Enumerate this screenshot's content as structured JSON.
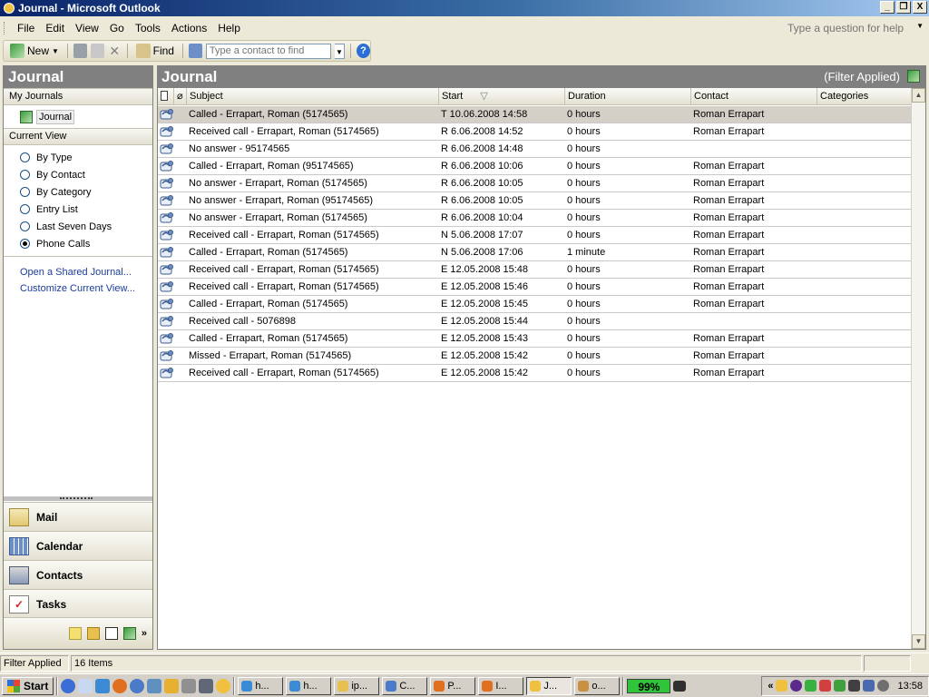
{
  "window": {
    "title": "Journal - Microsoft Outlook",
    "min_label": "_",
    "max_label": "❐",
    "close_label": "X"
  },
  "menu": {
    "items": [
      "File",
      "Edit",
      "View",
      "Go",
      "Tools",
      "Actions",
      "Help"
    ],
    "ask_placeholder": "Type a question for help"
  },
  "toolbar": {
    "new_label": "New",
    "find_label": "Find",
    "contact_placeholder": "Type a contact to find"
  },
  "nav": {
    "title": "Journal",
    "my_journals_label": "My Journals",
    "journal_item": "Journal",
    "current_view_label": "Current View",
    "views": [
      {
        "label": "By Type",
        "selected": false
      },
      {
        "label": "By Contact",
        "selected": false
      },
      {
        "label": "By Category",
        "selected": false
      },
      {
        "label": "Entry List",
        "selected": false
      },
      {
        "label": "Last Seven Days",
        "selected": false
      },
      {
        "label": "Phone Calls",
        "selected": true
      }
    ],
    "links": [
      "Open a Shared Journal...",
      "Customize Current View..."
    ],
    "buttons": [
      "Mail",
      "Calendar",
      "Contacts",
      "Tasks"
    ]
  },
  "main": {
    "title": "Journal",
    "filter_status": "(Filter Applied)",
    "columns": [
      "Subject",
      "Start",
      "Duration",
      "Contact",
      "Categories"
    ],
    "sort_indicator": "▽",
    "rows": [
      {
        "subject": "Called - Errapart, Roman (5174565)",
        "start": "T 10.06.2008 14:58",
        "duration": "0 hours",
        "contact": "Roman Errapart"
      },
      {
        "subject": "Received call - Errapart, Roman (5174565)",
        "start": "R 6.06.2008 14:52",
        "duration": "0 hours",
        "contact": "Roman Errapart"
      },
      {
        "subject": "No answer - 95174565",
        "start": "R 6.06.2008 14:48",
        "duration": "0 hours",
        "contact": ""
      },
      {
        "subject": "Called - Errapart, Roman (95174565)",
        "start": "R 6.06.2008 10:06",
        "duration": "0 hours",
        "contact": "Roman Errapart"
      },
      {
        "subject": "No answer - Errapart, Roman (5174565)",
        "start": "R 6.06.2008 10:05",
        "duration": "0 hours",
        "contact": "Roman Errapart"
      },
      {
        "subject": "No answer - Errapart, Roman (95174565)",
        "start": "R 6.06.2008 10:05",
        "duration": "0 hours",
        "contact": "Roman Errapart"
      },
      {
        "subject": "No answer - Errapart, Roman (5174565)",
        "start": "R 6.06.2008 10:04",
        "duration": "0 hours",
        "contact": "Roman Errapart"
      },
      {
        "subject": "Received call - Errapart, Roman (5174565)",
        "start": "N 5.06.2008 17:07",
        "duration": "0 hours",
        "contact": "Roman Errapart"
      },
      {
        "subject": "Called - Errapart, Roman (5174565)",
        "start": "N 5.06.2008 17:06",
        "duration": "1 minute",
        "contact": "Roman Errapart"
      },
      {
        "subject": "Received call - Errapart, Roman (5174565)",
        "start": "E 12.05.2008 15:48",
        "duration": "0 hours",
        "contact": "Roman Errapart"
      },
      {
        "subject": "Received call - Errapart, Roman (5174565)",
        "start": "E 12.05.2008 15:46",
        "duration": "0 hours",
        "contact": "Roman Errapart"
      },
      {
        "subject": "Called - Errapart, Roman (5174565)",
        "start": "E 12.05.2008 15:45",
        "duration": "0 hours",
        "contact": "Roman Errapart"
      },
      {
        "subject": "Received call - 5076898",
        "start": "E 12.05.2008 15:44",
        "duration": "0 hours",
        "contact": ""
      },
      {
        "subject": "Called - Errapart, Roman (5174565)",
        "start": "E 12.05.2008 15:43",
        "duration": "0 hours",
        "contact": "Roman Errapart"
      },
      {
        "subject": "Missed - Errapart, Roman (5174565)",
        "start": "E 12.05.2008 15:42",
        "duration": "0 hours",
        "contact": "Roman Errapart"
      },
      {
        "subject": "Received call - Errapart, Roman (5174565)",
        "start": "E 12.05.2008 15:42",
        "duration": "0 hours",
        "contact": "Roman Errapart"
      }
    ]
  },
  "status": {
    "filter": "Filter Applied",
    "count": "16 Items"
  },
  "taskbar": {
    "start_label": "Start",
    "tasks": [
      "h...",
      "h...",
      "ip...",
      "C...",
      "P...",
      "I...",
      "J...",
      "o..."
    ],
    "battery": "99%",
    "clock": "13:58",
    "tray_chevron": "«"
  },
  "colors": {
    "titlebar": "#0a246a",
    "pane_header": "#808080",
    "selection": "#d4d0c8",
    "link": "#1a3c9c",
    "battery": "#2fc43a"
  }
}
